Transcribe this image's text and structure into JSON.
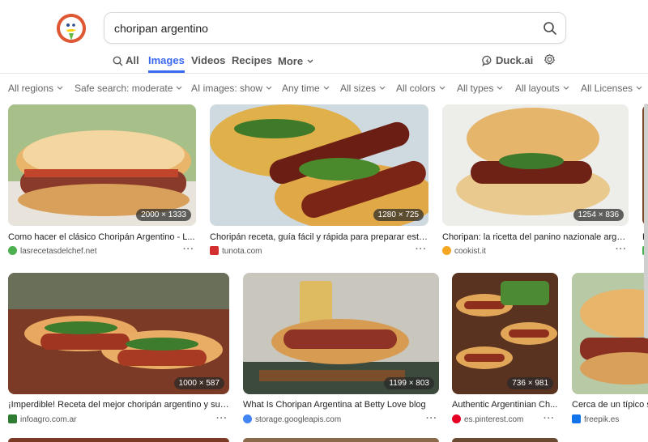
{
  "search": {
    "query": "choripan argentino"
  },
  "tabs": [
    {
      "label": "All",
      "active": false
    },
    {
      "label": "Images",
      "active": true
    },
    {
      "label": "Videos",
      "active": false
    },
    {
      "label": "Recipes",
      "active": false
    },
    {
      "label": "More",
      "active": false
    }
  ],
  "duckai": {
    "label": "Duck.ai"
  },
  "filters": {
    "regions": "All regions",
    "safe": "Safe search: moderate",
    "ai": "AI images: show",
    "time": "Any time",
    "sizes": "All sizes",
    "colors": "All colors",
    "types": "All types",
    "layouts": "All layouts",
    "licenses": "All Licenses"
  },
  "results": [
    {
      "title": "Como hacer el clásico Choripán Argentino - L...",
      "dims": "2000 × 1333",
      "source": "lasrecetasdelchef.net",
      "fav_color": "#4caf50"
    },
    {
      "title": "Choripán receta, guía fácil y rápida para preparar esta ...",
      "dims": "1280 × 725",
      "source": "tunota.com",
      "fav_color": "#d32f2f"
    },
    {
      "title": "Choripan: la ricetta del panino nazionale arge...",
      "dims": "1254 × 836",
      "source": "cookist.it",
      "fav_color": "#f5a623"
    },
    {
      "title": "R",
      "dims": "",
      "source": "",
      "fav_color": "#4caf50"
    },
    {
      "title": "¡Imperdible! Receta del mejor choripán argentino y sus...",
      "dims": "1000 × 587",
      "source": "infoagro.com.ar",
      "fav_color": "#2e7d32"
    },
    {
      "title": "What Is Choripan Argentina at Betty Love blog",
      "dims": "1199 × 803",
      "source": "storage.googleapis.com",
      "fav_color": "#4285f4"
    },
    {
      "title": "Authentic Argentinian Ch...",
      "dims": "736 × 981",
      "source": "es.pinterest.com",
      "fav_color": "#e60023"
    },
    {
      "title": "Cerca de un típico s",
      "dims": "",
      "source": "freepik.es",
      "fav_color": "#1273eb"
    }
  ]
}
